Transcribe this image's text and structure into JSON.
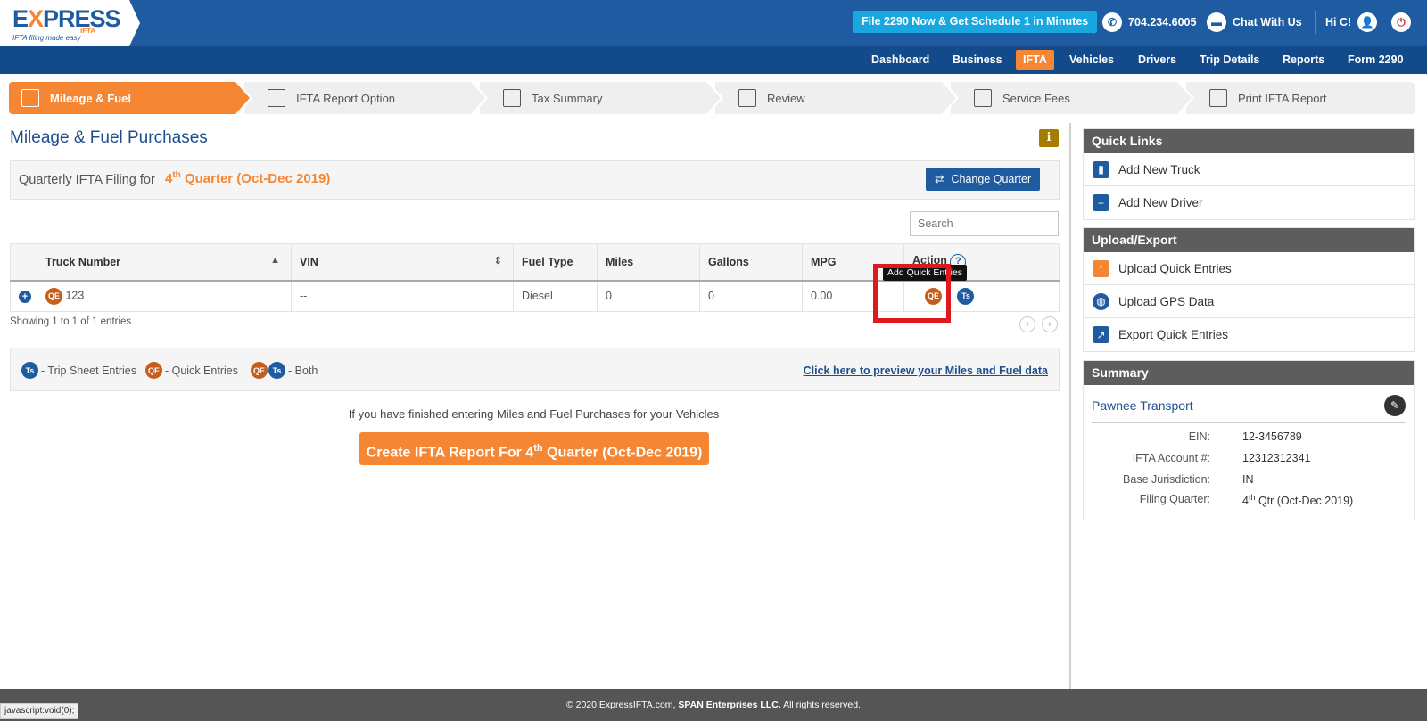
{
  "brand": {
    "word_pre": "E",
    "word_x": "X",
    "word_post": "PRESS",
    "sub": "IFTA",
    "tagline": "IFTA filing made easy"
  },
  "header": {
    "promo": "File 2290 Now & Get Schedule 1 in Minutes",
    "phone": "704.234.6005",
    "chat": "Chat With Us",
    "greeting": "Hi C!"
  },
  "nav": {
    "items": [
      "Dashboard",
      "Business",
      "IFTA",
      "Vehicles",
      "Drivers",
      "Trip Details",
      "Reports",
      "Form 2290"
    ],
    "active": "IFTA"
  },
  "steps": [
    "Mileage & Fuel",
    "IFTA Report Option",
    "Tax Summary",
    "Review",
    "Service Fees",
    "Print IFTA Report"
  ],
  "main": {
    "title": "Mileage & Fuel Purchases",
    "info": "i",
    "quarter_label": "Quarterly IFTA Filing for",
    "quarter_num": "4",
    "quarter_sup": "th",
    "quarter_rest": " Quarter (Oct-Dec 2019)",
    "change_quarter": "Change Quarter",
    "search_placeholder": "Search"
  },
  "table": {
    "headers": [
      "Truck Number",
      "VIN",
      "Fuel Type",
      "Miles",
      "Gallons",
      "MPG",
      "Action"
    ],
    "rows": [
      {
        "badge": "QE",
        "truck": "123",
        "vin": "--",
        "fuel": "Diesel",
        "miles": "0",
        "gallons": "0",
        "mpg": "0.00"
      }
    ],
    "tooltip": "Add Quick Entries",
    "showing": "Showing 1 to 1 of 1 entries"
  },
  "legend": {
    "ts_badge": "Ts",
    "qe_badge": "QE",
    "trip": "- Trip Sheet Entries",
    "quick": "- Quick Entries",
    "both": "- Both",
    "preview_link": "Click here to preview your Miles and Fuel data"
  },
  "finish": {
    "text": "If you have finished entering Miles and Fuel Purchases for your Vehicles",
    "btn_pre": "Create IFTA Report For 4",
    "btn_sup": "th",
    "btn_post": " Quarter (Oct-Dec 2019)"
  },
  "quick_links": {
    "title": "Quick Links",
    "items": [
      "Add New Truck",
      "Add New Driver"
    ]
  },
  "upload_export": {
    "title": "Upload/Export",
    "items": [
      "Upload Quick Entries",
      "Upload GPS Data",
      "Export Quick Entries"
    ]
  },
  "summary": {
    "title": "Summary",
    "company": "Pawnee Transport",
    "rows": [
      {
        "k": "EIN:",
        "v": "12-3456789"
      },
      {
        "k": "IFTA Account #:",
        "v": "12312312341"
      },
      {
        "k": "Base Jurisdiction:",
        "v": "IN"
      },
      {
        "k": "Filing Quarter:",
        "v_pre": "4",
        "v_sup": "th",
        "v_post": " Qtr (Oct-Dec 2019)"
      }
    ]
  },
  "footer": {
    "pre": "© 2020 ExpressIFTA.com, ",
    "bold": "SPAN Enterprises LLC.",
    "post": " All rights reserved."
  },
  "status": "javascript:void(0);",
  "colors": {
    "primary": "#1f5ba0",
    "accent": "#f58634",
    "highlight": "#e0191f"
  }
}
